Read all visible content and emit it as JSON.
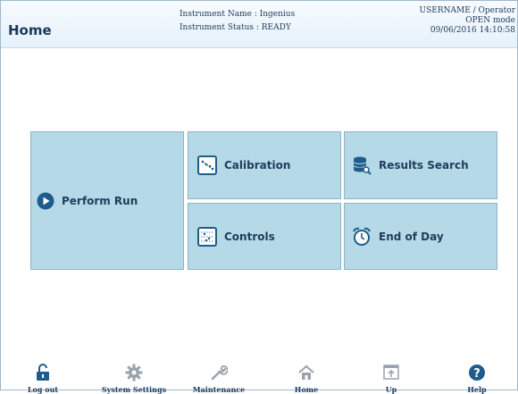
{
  "header": {
    "title": "Home",
    "instrument_name": "Instrument Name : Ingenius",
    "instrument_status": "Instrument Status : READY",
    "user": "USERNAME / Operator",
    "mode": "OPEN mode",
    "datetime": "09/06/2016 14:10:58"
  },
  "tiles": {
    "perform_run": "Perform Run",
    "calibration": "Calibration",
    "controls": "Controls",
    "results_search": "Results Search",
    "end_of_day": "End of Day"
  },
  "footer": {
    "logout": "Log out",
    "system_settings": "System Settings",
    "maintenance": "Maintenance",
    "home": "Home",
    "up": "Up",
    "help": "Help"
  },
  "colors": {
    "tile_bg": "#b5d9e6",
    "accent": "#1f5c8c",
    "text": "#1b3a5c"
  }
}
